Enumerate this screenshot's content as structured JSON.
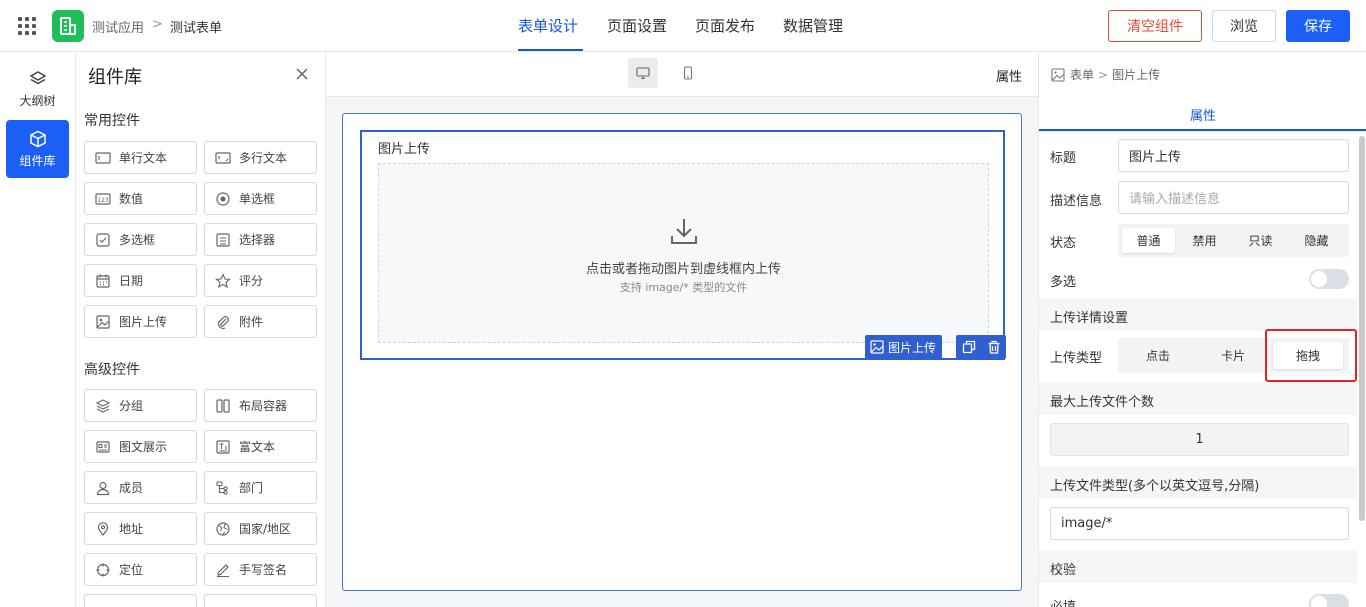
{
  "header": {
    "breadcrumb": [
      "测试应用",
      ">",
      "测试表单"
    ],
    "tabs": [
      {
        "label": "表单设计",
        "active": true
      },
      {
        "label": "页面设置",
        "active": false
      },
      {
        "label": "页面发布",
        "active": false
      },
      {
        "label": "数据管理",
        "active": false
      }
    ],
    "clear_label": "清空组件",
    "preview_label": "浏览",
    "save_label": "保存"
  },
  "rail": {
    "items": [
      {
        "label": "大纲树",
        "icon": "layers-icon",
        "active": false
      },
      {
        "label": "组件库",
        "icon": "cube-icon",
        "active": true
      }
    ]
  },
  "library": {
    "title": "组件库",
    "common_title": "常用控件",
    "common": [
      {
        "label": "单行文本",
        "icon": "single-line-icon"
      },
      {
        "label": "多行文本",
        "icon": "multi-line-icon"
      },
      {
        "label": "数值",
        "icon": "number-icon"
      },
      {
        "label": "单选框",
        "icon": "radio-icon"
      },
      {
        "label": "多选框",
        "icon": "checkbox-icon"
      },
      {
        "label": "选择器",
        "icon": "select-icon"
      },
      {
        "label": "日期",
        "icon": "calendar-icon"
      },
      {
        "label": "评分",
        "icon": "star-icon"
      },
      {
        "label": "图片上传",
        "icon": "image-icon"
      },
      {
        "label": "附件",
        "icon": "paperclip-icon"
      }
    ],
    "advanced_title": "高级控件",
    "advanced": [
      {
        "label": "分组",
        "icon": "layers-icon"
      },
      {
        "label": "布局容器",
        "icon": "columns-icon"
      },
      {
        "label": "图文展示",
        "icon": "card-icon"
      },
      {
        "label": "富文本",
        "icon": "rich-text-icon"
      },
      {
        "label": "成员",
        "icon": "user-icon"
      },
      {
        "label": "部门",
        "icon": "tree-icon"
      },
      {
        "label": "地址",
        "icon": "map-pin-icon"
      },
      {
        "label": "国家/地区",
        "icon": "globe-icon"
      },
      {
        "label": "定位",
        "icon": "target-icon"
      },
      {
        "label": "手写签名",
        "icon": "pen-icon"
      }
    ]
  },
  "canvas": {
    "property_label": "属性",
    "field": {
      "label": "图片上传",
      "drop_main": "点击或者拖动图片到虚线框内上传",
      "drop_sub": "支持 image/* 类型的文件",
      "tag_label": "图片上传"
    }
  },
  "props": {
    "breadcrumb": [
      "表单",
      ">",
      "图片上传"
    ],
    "tab": "属性",
    "title_label": "标题",
    "title_value": "图片上传",
    "desc_label": "描述信息",
    "desc_placeholder": "请输入描述信息",
    "state_label": "状态",
    "states": [
      {
        "label": "普通",
        "active": true
      },
      {
        "label": "禁用",
        "active": false
      },
      {
        "label": "只读",
        "active": false
      },
      {
        "label": "隐藏",
        "active": false
      }
    ],
    "multi_label": "多选",
    "multi_on": false,
    "upload_section": "上传详情设置",
    "upload_type_label": "上传类型",
    "upload_types": [
      {
        "label": "点击",
        "active": false
      },
      {
        "label": "卡片",
        "active": false
      },
      {
        "label": "拖拽",
        "active": true
      }
    ],
    "max_count_section": "最大上传文件个数",
    "max_count_value": "1",
    "file_type_section": "上传文件类型(多个以英文逗号,分隔)",
    "file_type_value": "image/*",
    "validate_section": "校验",
    "required_label": "必填",
    "required_on": false
  },
  "colors": {
    "primary": "#1a5ff6",
    "danger": "#e04e36",
    "app_logo": "#1fbe5a",
    "highlight": "#e02424"
  }
}
